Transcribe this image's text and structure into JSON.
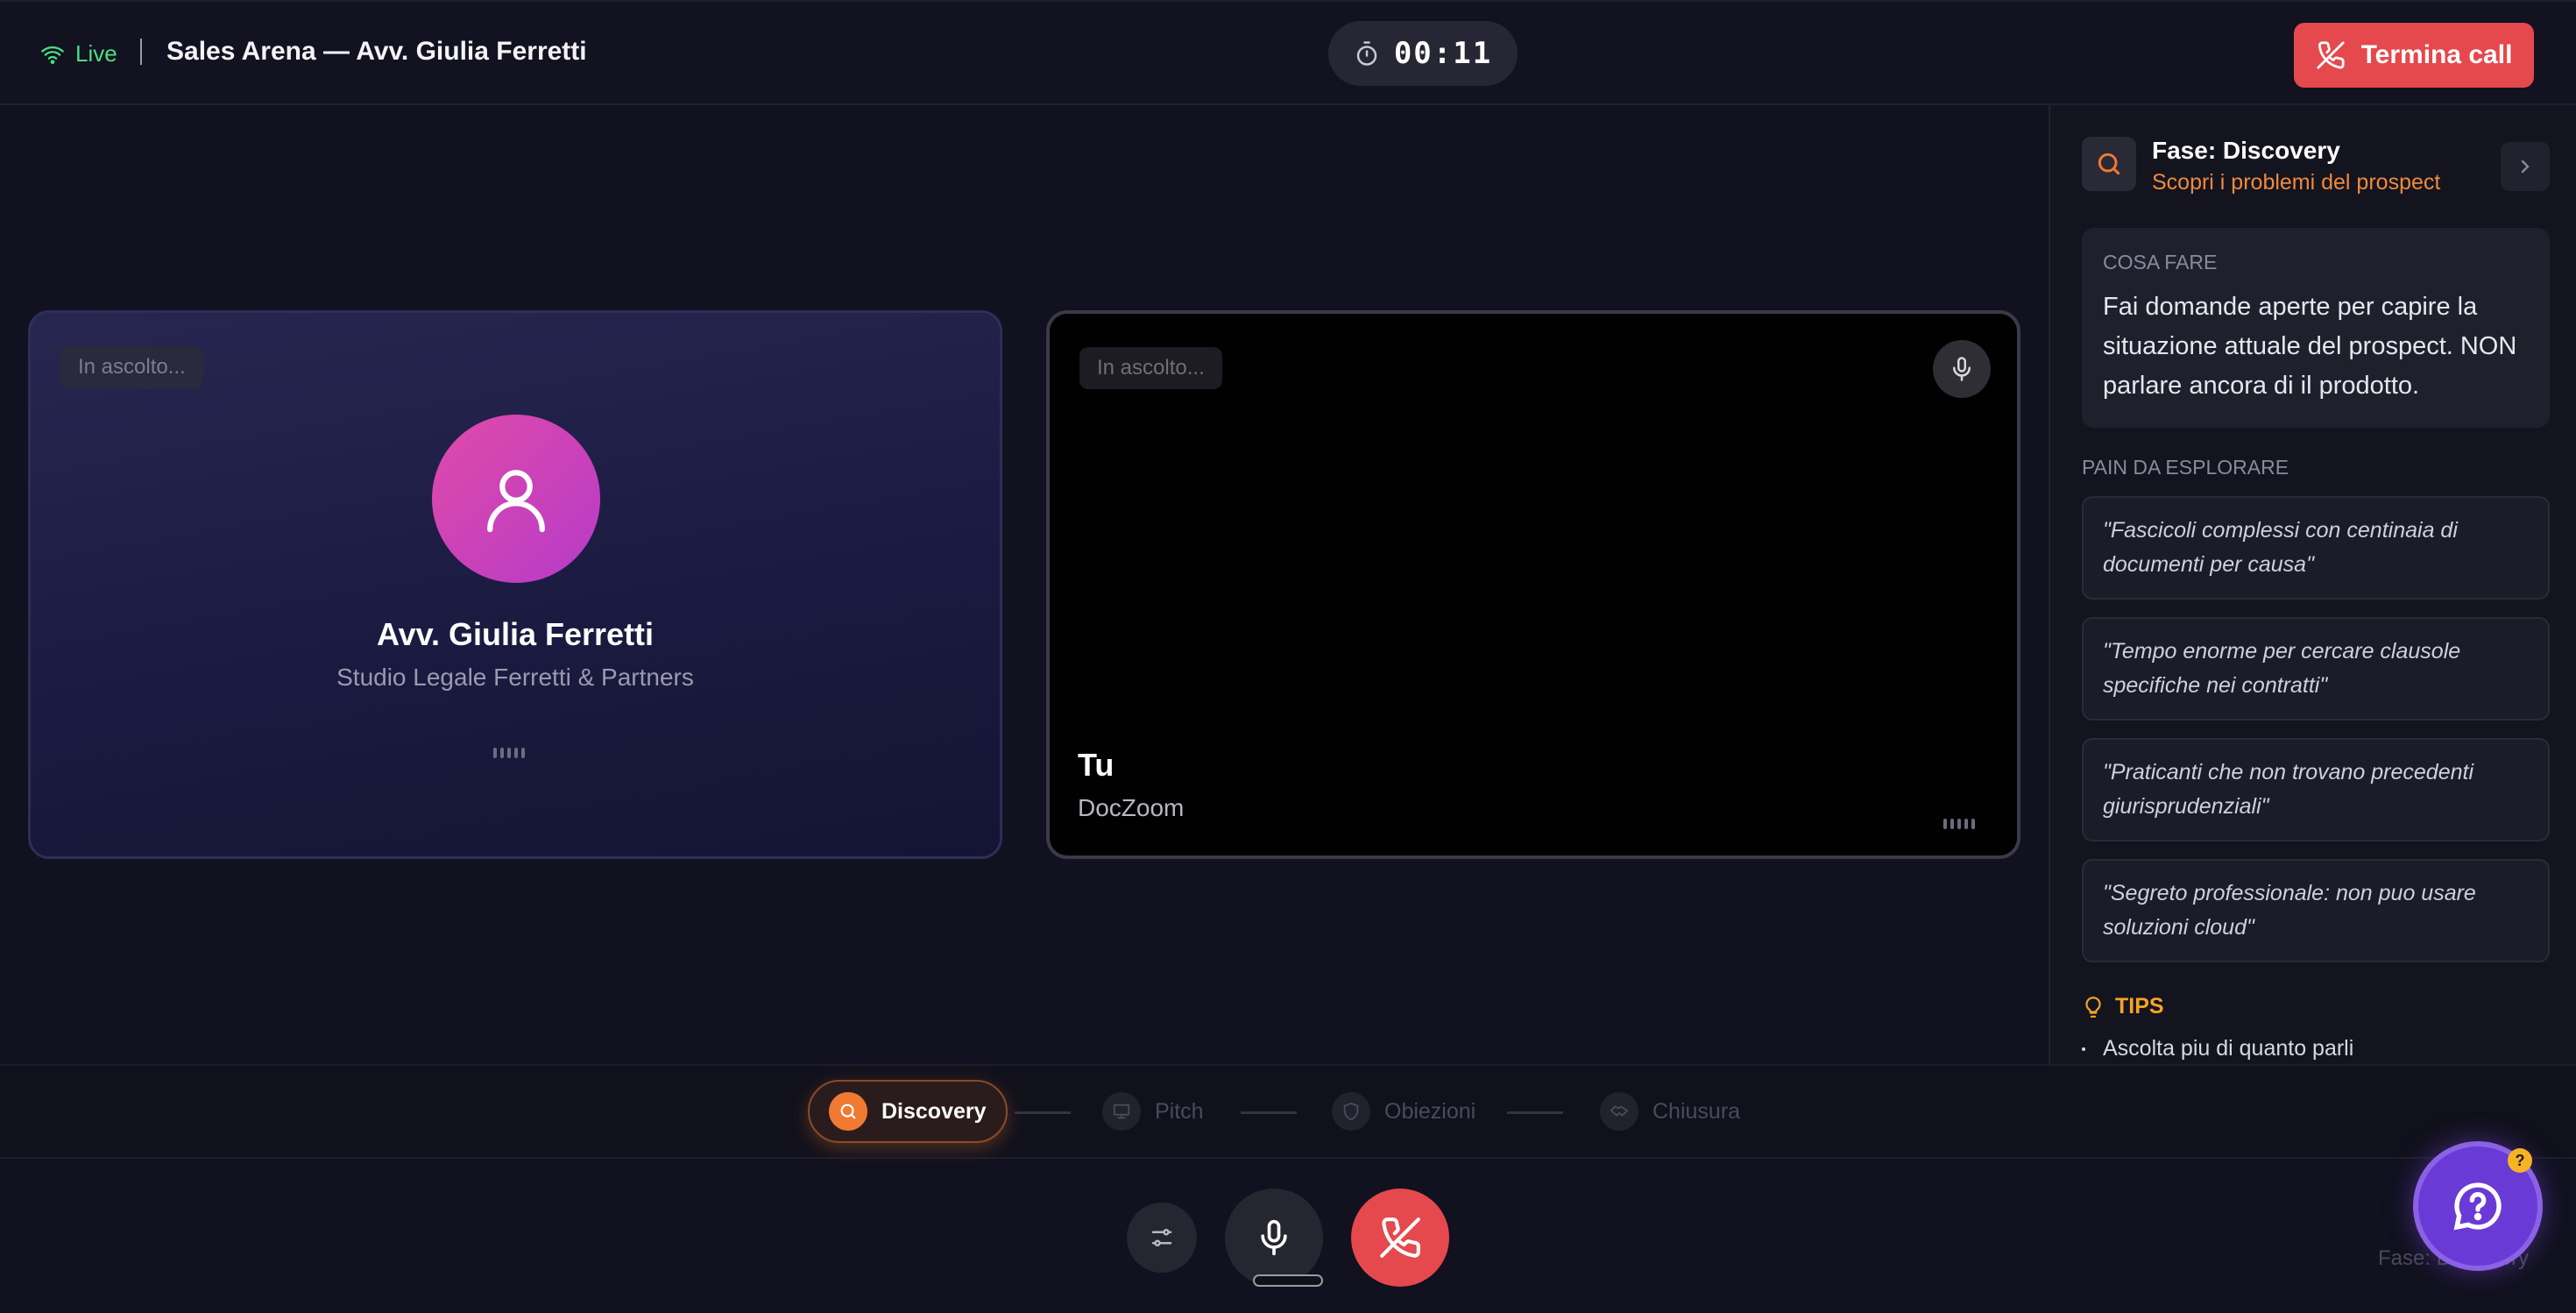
{
  "header": {
    "live_label": "Live",
    "title": "Sales Arena — Avv. Giulia Ferretti",
    "timer": "00:11",
    "end_call_label": "Termina call"
  },
  "prospect": {
    "status": "In ascolto...",
    "name": "Avv. Giulia Ferretti",
    "company": "Studio Legale Ferretti & Partners"
  },
  "self": {
    "status": "In ascolto...",
    "name": "Tu",
    "company": "DocZoom"
  },
  "panel": {
    "phase_title": "Fase: Discovery",
    "phase_subtitle": "Scopri i problemi del prospect",
    "todo_label": "COSA FARE",
    "todo_text": "Fai domande aperte per capire la situazione attuale del prospect. NON parlare ancora di il prodotto.",
    "pain_label": "PAIN DA ESPLORARE",
    "pains": [
      "\"Fascicoli complessi con centinaia di documenti per causa\"",
      "\"Tempo enorme per cercare clausole specifiche nei contratti\"",
      "\"Praticanti che non trovano precedenti giurisprudenziali\"",
      "\"Segreto professionale: non puo usare soluzioni cloud\""
    ],
    "tips_label": "TIPS",
    "tips": [
      "Ascolta piu di quanto parli"
    ]
  },
  "stepper": {
    "steps": [
      {
        "label": "Discovery",
        "icon": "search-icon",
        "active": true
      },
      {
        "label": "Pitch",
        "icon": "presentation-icon",
        "active": false
      },
      {
        "label": "Obiezioni",
        "icon": "shield-icon",
        "active": false
      },
      {
        "label": "Chiusura",
        "icon": "handshake-icon",
        "active": false
      }
    ]
  },
  "footer": {
    "phase_label": "Fase: Discovery",
    "help_badge": "?"
  },
  "colors": {
    "accent_orange": "#f07a32",
    "danger": "#e5484d",
    "live_green": "#4ade80",
    "help_purple": "#6a3ad6"
  }
}
